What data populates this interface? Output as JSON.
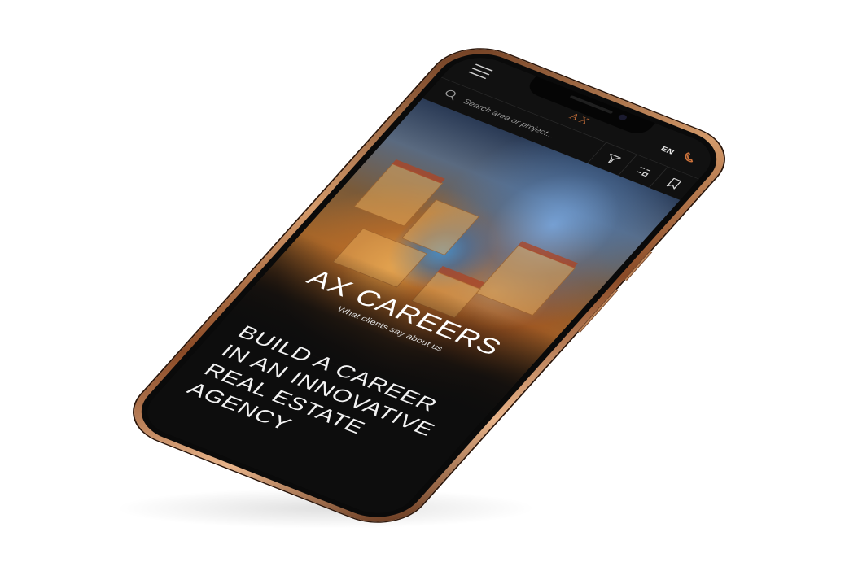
{
  "header": {
    "language": "EN",
    "logo_text": "AX"
  },
  "search": {
    "placeholder": "Search area or project..."
  },
  "toolbar": {
    "filter_icon": "filter-icon",
    "list_icon": "list-view-icon",
    "bookmark_icon": "bookmark-icon"
  },
  "hero": {
    "title": "AX CAREERS",
    "subtitle": "What clients say about us"
  },
  "content": {
    "headline": "BUILD A CAREER IN AN INNOVATIVE REAL ESTATE AGENCY"
  },
  "colors": {
    "accent": "#c9703a",
    "background": "#0d0d0d",
    "frame": "#b87a4b"
  }
}
